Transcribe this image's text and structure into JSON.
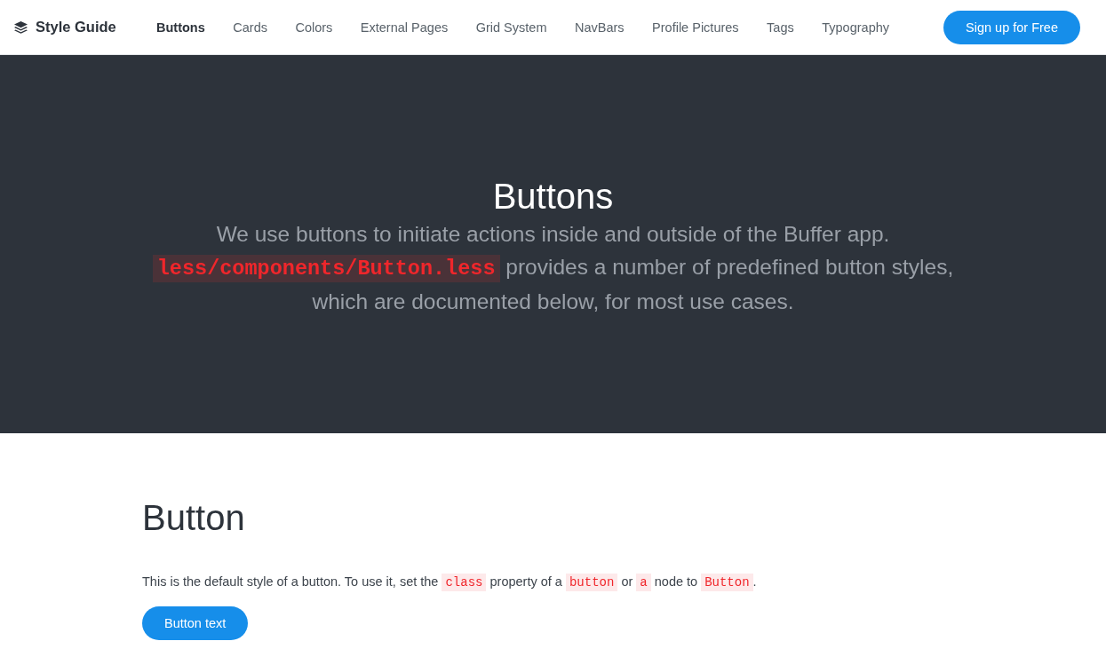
{
  "header": {
    "logo": "Style Guide",
    "nav": [
      {
        "label": "Buttons",
        "selected": true
      },
      {
        "label": "Cards",
        "selected": false
      },
      {
        "label": "Colors",
        "selected": false
      },
      {
        "label": "External Pages",
        "selected": false
      },
      {
        "label": "Grid System",
        "selected": false
      },
      {
        "label": "NavBars",
        "selected": false
      },
      {
        "label": "Profile Pictures",
        "selected": false
      },
      {
        "label": "Tags",
        "selected": false
      },
      {
        "label": "Typography",
        "selected": false
      }
    ],
    "cta": "Sign up for Free"
  },
  "hero": {
    "title": "Buttons",
    "description": [
      {
        "kind": "text",
        "text": "We use buttons to initiate actions inside and outside of the Buffer app. "
      },
      {
        "kind": "code",
        "text": "less/components/Button.less"
      },
      {
        "kind": "text",
        "text": " provides a number of predefined button styles, which are documented below, for most use cases."
      }
    ]
  },
  "section": {
    "heading": "Button",
    "description": [
      {
        "kind": "text",
        "text": "This is the default style of a button. To use it, set the "
      },
      {
        "kind": "code",
        "text": "class"
      },
      {
        "kind": "text",
        "text": " property of a "
      },
      {
        "kind": "code",
        "text": "button"
      },
      {
        "kind": "text",
        "text": " or "
      },
      {
        "kind": "code",
        "text": "a"
      },
      {
        "kind": "text",
        "text": " node to "
      },
      {
        "kind": "code",
        "text": "Button"
      },
      {
        "kind": "text",
        "text": "."
      }
    ],
    "example_button": "Button text"
  }
}
